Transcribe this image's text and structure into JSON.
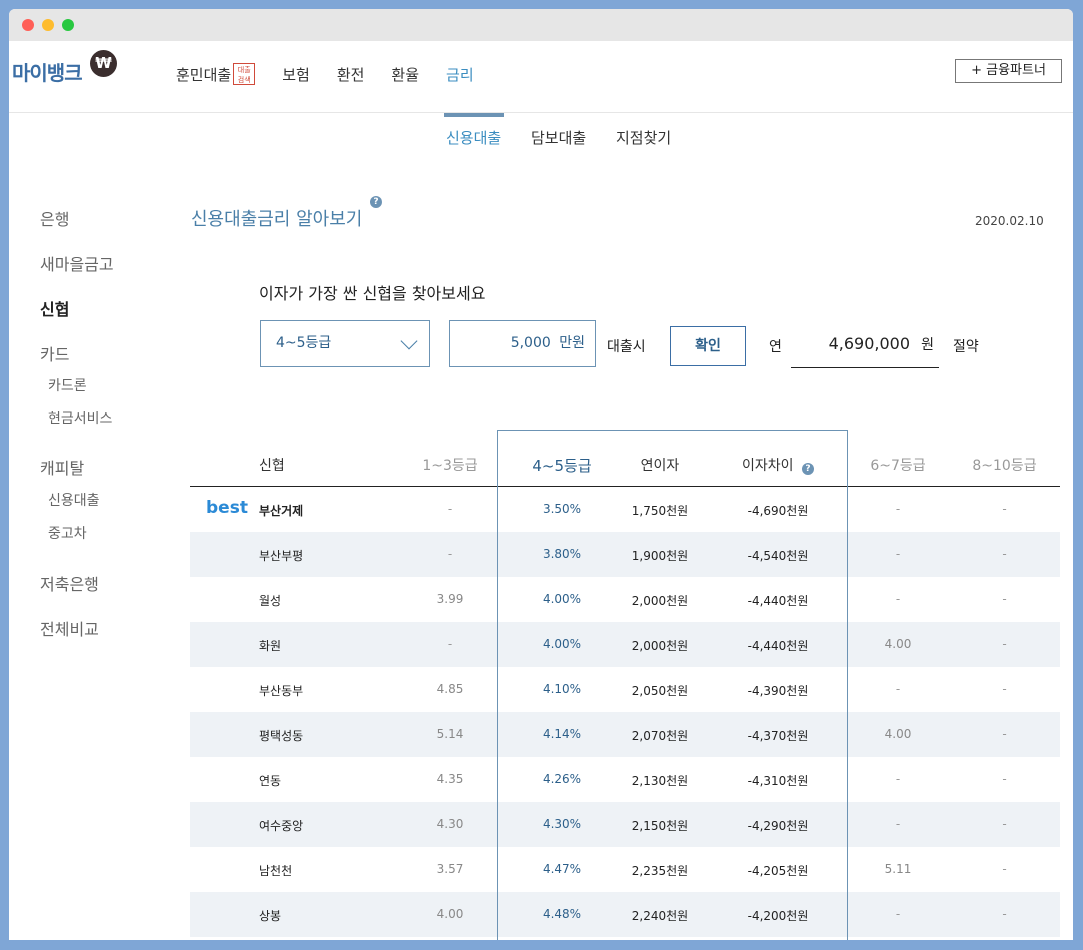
{
  "logo": {
    "text": "마이뱅크",
    "badge": "₩"
  },
  "nav": {
    "items": [
      {
        "label": "훈민대출",
        "badge": "대출\n검색"
      },
      {
        "label": "보험"
      },
      {
        "label": "환전"
      },
      {
        "label": "환율"
      },
      {
        "label": "금리"
      }
    ],
    "partner": "+ 금융파트너"
  },
  "subnav": {
    "items": [
      "신용대출",
      "담보대출",
      "지점찾기"
    ]
  },
  "sidebar": {
    "items": [
      "은행",
      "새마을금고",
      "신협",
      "카드",
      "캐피탈",
      "저축은행",
      "전체비교"
    ],
    "card_sub": [
      "카드론",
      "현금서비스"
    ],
    "capital_sub": [
      "신용대출",
      "중고차"
    ]
  },
  "page": {
    "title": "신용대출금리 알아보기",
    "help": "?",
    "date": "2020.02.10"
  },
  "calc": {
    "prompt": "이자가 가장 싼 신협을 찾아보세요",
    "grade": "4~5등급",
    "amount": "5,000",
    "amount_unit": "만원",
    "loan_label": "대출시",
    "confirm": "확인",
    "year_label": "연",
    "savings": "4,690,000",
    "savings_unit": "원",
    "save_label": "절약"
  },
  "table": {
    "headers": {
      "name": "신협",
      "g13": "1~3등급",
      "g45": "4~5등급",
      "interest": "연이자",
      "diff": "이자차이",
      "g67": "6~7등급",
      "g810": "8~10등급"
    },
    "best_label": "best",
    "rows": [
      {
        "name": "부산거제",
        "g13": "-",
        "g45": "3.50%",
        "interest": "1,750천원",
        "diff": "-4,690천원",
        "g67": "-",
        "g810": "-"
      },
      {
        "name": "부산부평",
        "g13": "-",
        "g45": "3.80%",
        "interest": "1,900천원",
        "diff": "-4,540천원",
        "g67": "-",
        "g810": "-"
      },
      {
        "name": "월성",
        "g13": "3.99",
        "g45": "4.00%",
        "interest": "2,000천원",
        "diff": "-4,440천원",
        "g67": "-",
        "g810": "-"
      },
      {
        "name": "화원",
        "g13": "-",
        "g45": "4.00%",
        "interest": "2,000천원",
        "diff": "-4,440천원",
        "g67": "4.00",
        "g810": "-"
      },
      {
        "name": "부산동부",
        "g13": "4.85",
        "g45": "4.10%",
        "interest": "2,050천원",
        "diff": "-4,390천원",
        "g67": "-",
        "g810": "-"
      },
      {
        "name": "평택성동",
        "g13": "5.14",
        "g45": "4.14%",
        "interest": "2,070천원",
        "diff": "-4,370천원",
        "g67": "4.00",
        "g810": "-"
      },
      {
        "name": "연동",
        "g13": "4.35",
        "g45": "4.26%",
        "interest": "2,130천원",
        "diff": "-4,310천원",
        "g67": "-",
        "g810": "-"
      },
      {
        "name": "여수중앙",
        "g13": "4.30",
        "g45": "4.30%",
        "interest": "2,150천원",
        "diff": "-4,290천원",
        "g67": "-",
        "g810": "-"
      },
      {
        "name": "남천천",
        "g13": "3.57",
        "g45": "4.47%",
        "interest": "2,235천원",
        "diff": "-4,205천원",
        "g67": "5.11",
        "g810": "-"
      },
      {
        "name": "상봉",
        "g13": "4.00",
        "g45": "4.48%",
        "interest": "2,240천원",
        "diff": "-4,200천원",
        "g67": "-",
        "g810": "-"
      }
    ]
  }
}
